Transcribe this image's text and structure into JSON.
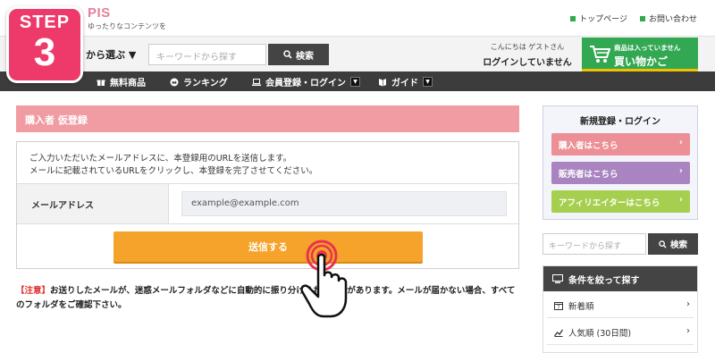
{
  "header": {
    "logo_text": "PIS",
    "tagline": "ゆったりなコンテンツを",
    "links": [
      "トップページ",
      "お問い合わせ"
    ]
  },
  "search": {
    "category_label": "から選ぶ ▼",
    "placeholder": "キーワードから探す",
    "button_label": "検索"
  },
  "user": {
    "greeting": "こんにちは ゲストさん",
    "status": "ログインしていません"
  },
  "cart": {
    "note": "商品は入っていません",
    "label": "買い物かご"
  },
  "nav": {
    "items": [
      "無料商品",
      "ランキング",
      "会員登録・ログイン",
      "ガイド"
    ]
  },
  "step": {
    "word": "STEP",
    "number": "3"
  },
  "main": {
    "title": "購入者 仮登録",
    "desc1": "ご入力いただいたメールアドレスに、本登録用のURLを送信します。",
    "desc2": "メールに記載されているURLをクリックし、本登録を完了させてください。",
    "email_label": "メールアドレス",
    "email_value": "example@example.com",
    "submit_label": "送信する",
    "notice_tag": "【注意】",
    "notice_text": "お送りしたメールが、迷惑メールフォルダなどに自動的に振り分けられる場合があります。メールが届かない場合、すべてのフォルダをご確認下さい。"
  },
  "sidebar": {
    "title": "新規登録・ログイン",
    "buttons": [
      "購入者はこちら",
      "販売者はこちら",
      "アフィリエイターはこちら"
    ],
    "search_placeholder": "キーワードから探す",
    "search_button": "検索",
    "filter_title": "条件を絞って探す",
    "filters": [
      "新着順",
      "人気順 (30日間)"
    ]
  },
  "colors": {
    "accent_pink": "#f09ca2",
    "submit_orange": "#f5a32a",
    "cart_green": "#33a852",
    "step_badge": "#ee3a6a"
  }
}
